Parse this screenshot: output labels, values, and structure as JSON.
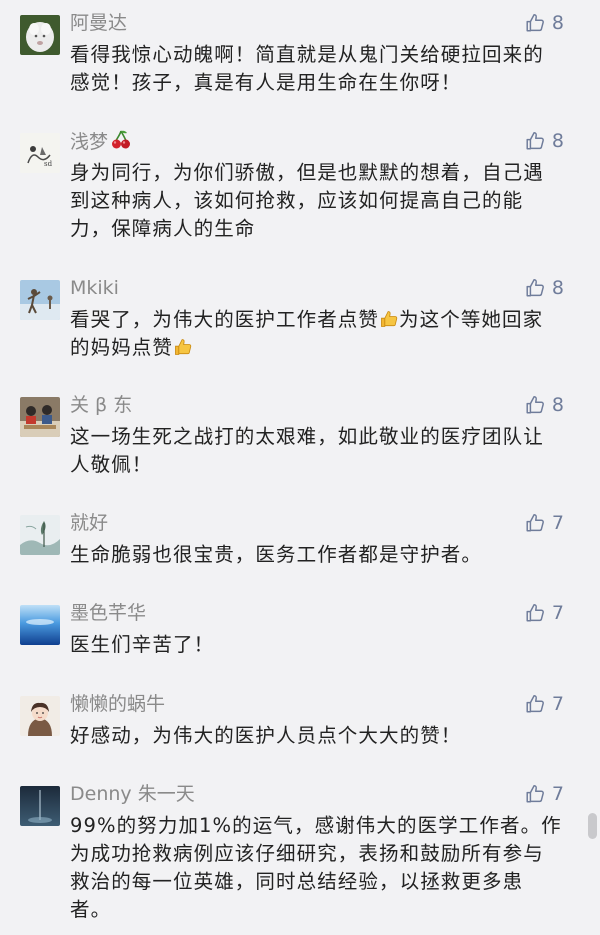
{
  "comments": [
    {
      "name": "阿曼达",
      "likes": "8",
      "text": "看得我惊心动魄啊！简直就是从鬼门关给硬拉回来的感觉！孩子，真是有人是用生命在生你呀！"
    },
    {
      "name": "浅梦",
      "name_emoji": "cherries-emoji",
      "likes": "8",
      "text": "身为同行，为你们骄傲，但是也默默的想着，自己遇到这种病人，该如何抢救，应该如何提高自己的能力，保障病人的生命"
    },
    {
      "name": "Mkiki",
      "likes": "8",
      "text_parts": [
        "看哭了，为伟大的医护工作者点赞",
        "为这个等她回家的妈妈点赞"
      ]
    },
    {
      "name": "关 β 东",
      "likes": "8",
      "text": "这一场生死之战打的太艰难，如此敬业的医疗团队让人敬佩！"
    },
    {
      "name": "就好",
      "likes": "7",
      "text": "生命脆弱也很宝贵，医务工作者都是守护者。"
    },
    {
      "name": "墨色芊华",
      "likes": "7",
      "text": "医生们辛苦了！"
    },
    {
      "name": "懒懒的蜗牛",
      "likes": "7",
      "text": "好感动，为伟大的医护人员点个大大的赞！"
    },
    {
      "name": "Denny 朱一天",
      "likes": "7",
      "text": "99%的努力加1%的运气，感谢伟大的医学工作者。作为成功抢救病例应该仔细研究，表扬和鼓励所有参与救治的每一位英雄，同时总结经验，以拯救更多患者。"
    }
  ],
  "icons": {
    "like": "thumbs-up-outline-icon",
    "inline_thumb": "thumbs-up-emoji"
  },
  "colors": {
    "background": "#f2f2f4",
    "name": "#8a8a8a",
    "like": "#6f7c9a",
    "text": "#222222"
  }
}
